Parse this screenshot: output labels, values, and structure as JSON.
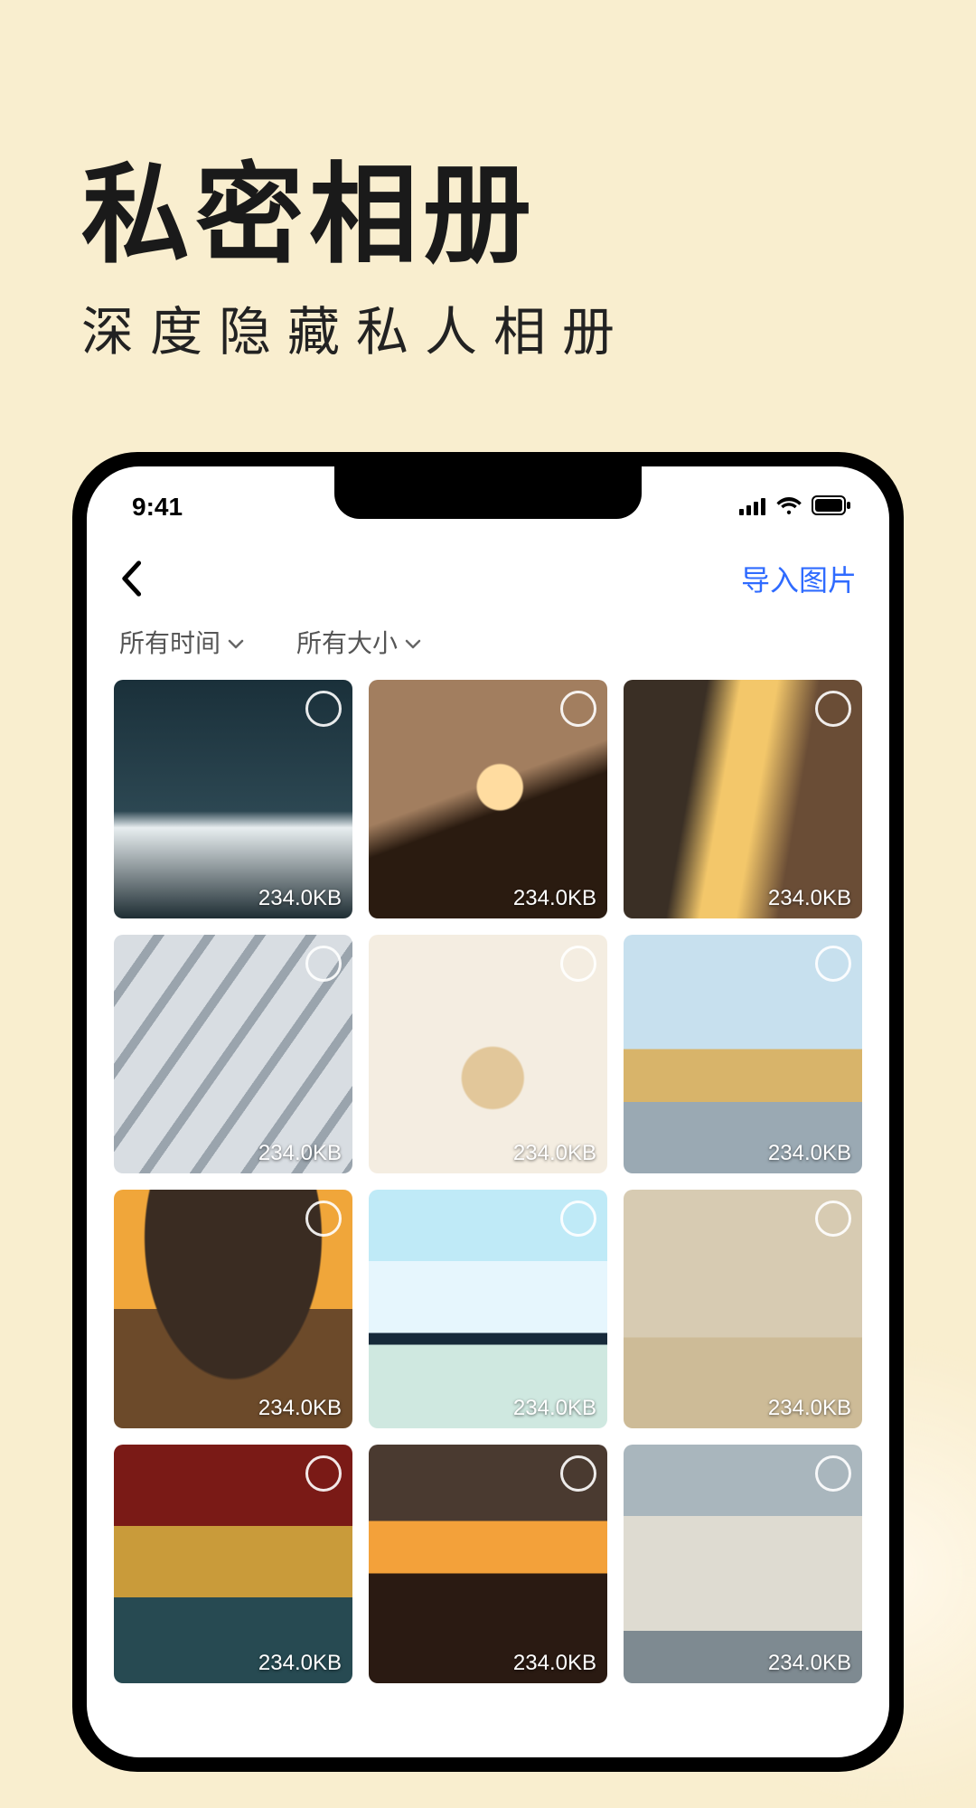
{
  "promo": {
    "title": "私密相册",
    "subtitle": "深度隐藏私人相册"
  },
  "status": {
    "time": "9:41"
  },
  "nav": {
    "import_label": "导入图片"
  },
  "filters": {
    "time_label": "所有时间",
    "size_label": "所有大小"
  },
  "photos": [
    {
      "size": "234.0KB"
    },
    {
      "size": "234.0KB"
    },
    {
      "size": "234.0KB"
    },
    {
      "size": "234.0KB"
    },
    {
      "size": "234.0KB"
    },
    {
      "size": "234.0KB"
    },
    {
      "size": "234.0KB"
    },
    {
      "size": "234.0KB"
    },
    {
      "size": "234.0KB"
    },
    {
      "size": "234.0KB"
    },
    {
      "size": "234.0KB"
    },
    {
      "size": "234.0KB"
    }
  ]
}
